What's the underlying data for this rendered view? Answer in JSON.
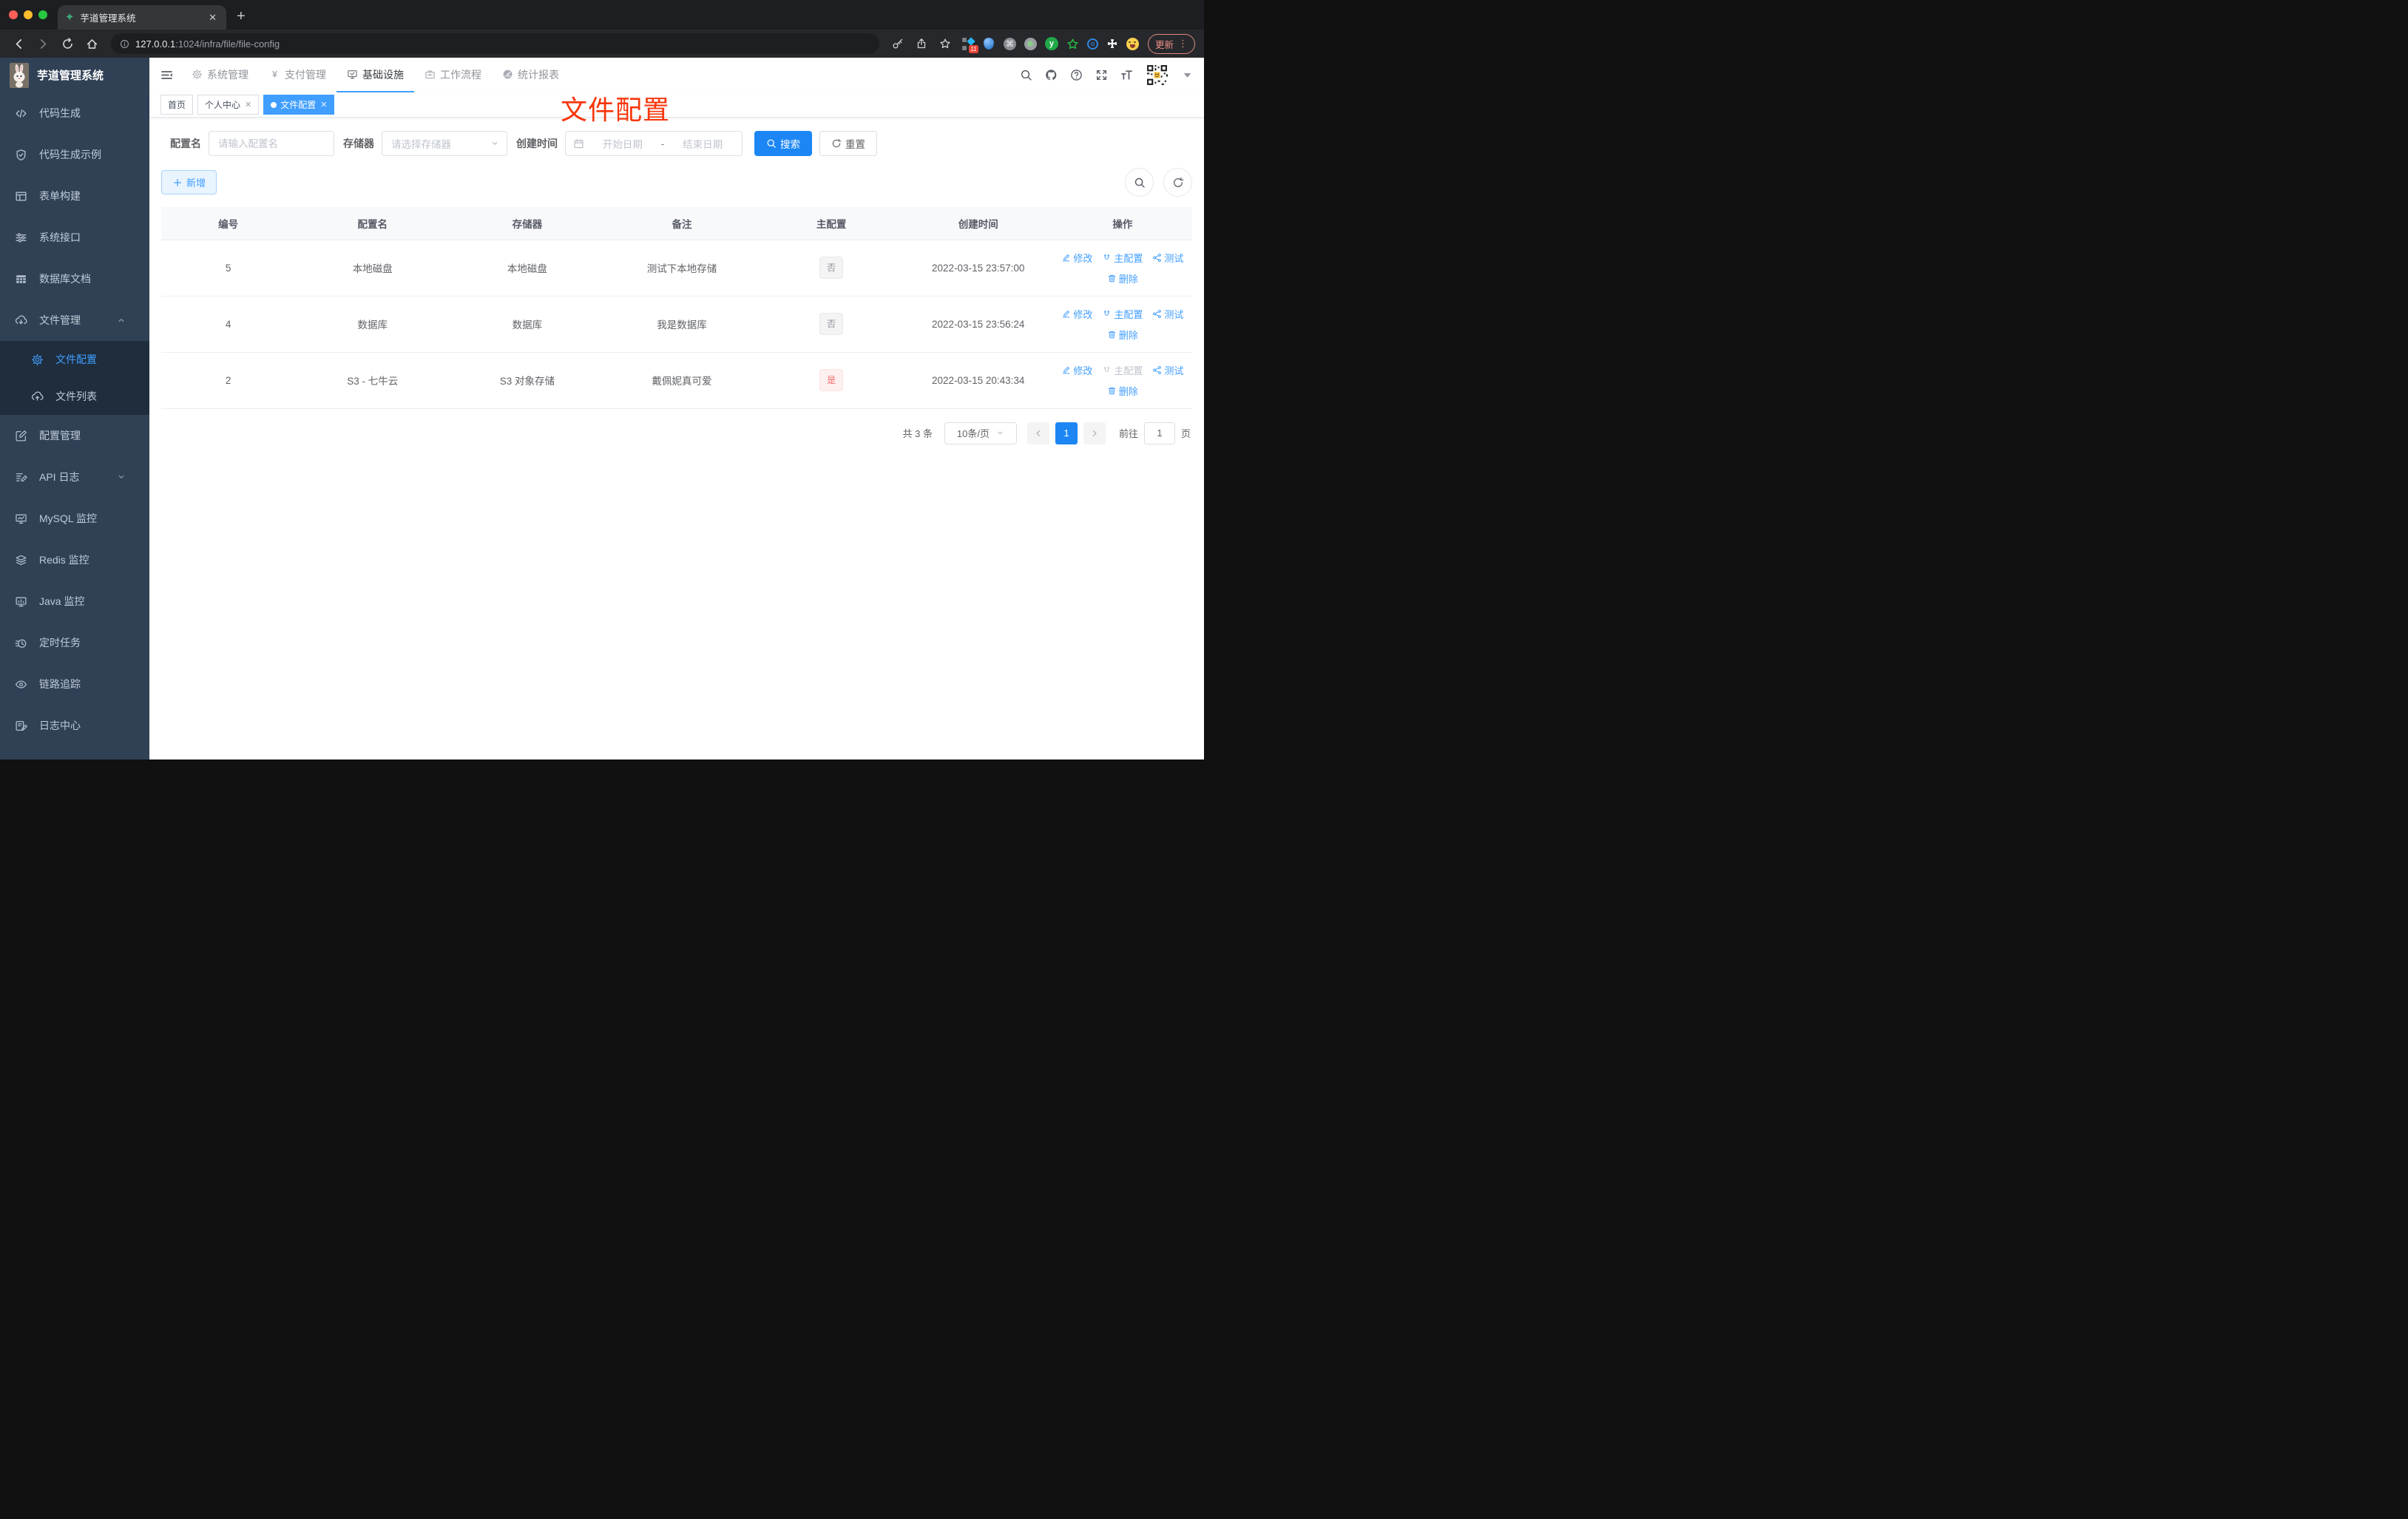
{
  "browser": {
    "tab_title": "芋道管理系统",
    "url_host": "127.0.0.1",
    "url_rest": ":1024/infra/file/file-config",
    "ext_badge": "11",
    "ext_y_label": "y",
    "ext_cmd_glyph": "⌘",
    "update_label": "更新"
  },
  "sidebar": {
    "title": "芋道管理系统",
    "items": [
      {
        "label": "代码生成",
        "icon": "code-icon"
      },
      {
        "label": "代码生成示例",
        "icon": "shield-check-icon"
      },
      {
        "label": "表单构建",
        "icon": "form-icon"
      },
      {
        "label": "系统接口",
        "icon": "sliders-icon"
      },
      {
        "label": "数据库文档",
        "icon": "grid-icon"
      },
      {
        "label": "文件管理",
        "icon": "cloud-download-icon",
        "expanded": true,
        "children": [
          {
            "label": "文件配置",
            "icon": "gear-icon",
            "active": true
          },
          {
            "label": "文件列表",
            "icon": "cloud-upload-icon"
          }
        ]
      },
      {
        "label": "配置管理",
        "icon": "edit-square-icon"
      },
      {
        "label": "API 日志",
        "icon": "note-edit-icon",
        "collapsible": true
      },
      {
        "label": "MySQL 监控",
        "icon": "monitor-chart-icon"
      },
      {
        "label": "Redis 监控",
        "icon": "layers-icon"
      },
      {
        "label": "Java 监控",
        "icon": "display-icon"
      },
      {
        "label": "定时任务",
        "icon": "timer-icon"
      },
      {
        "label": "链路追踪",
        "icon": "eye-icon"
      },
      {
        "label": "日志中心",
        "icon": "log-icon"
      }
    ]
  },
  "topnav": {
    "items": [
      {
        "label": "系统管理",
        "icon": "gear-icon"
      },
      {
        "label": "支付管理",
        "icon": "yen-icon"
      },
      {
        "label": "基础设施",
        "icon": "monitor-check-icon",
        "active": true
      },
      {
        "label": "工作流程",
        "icon": "briefcase-icon"
      },
      {
        "label": "统计报表",
        "icon": "dashboard-icon"
      }
    ]
  },
  "tags": [
    {
      "label": "首页"
    },
    {
      "label": "个人中心",
      "closable": true
    },
    {
      "label": "文件配置",
      "closable": true,
      "active": true
    }
  ],
  "annotation": {
    "text": "文件配置"
  },
  "filters": {
    "name_label": "配置名",
    "name_placeholder": "请输入配置名",
    "storage_label": "存储器",
    "storage_placeholder": "请选择存储器",
    "date_label": "创建时间",
    "date_start_placeholder": "开始日期",
    "date_separator": "-",
    "date_end_placeholder": "结束日期",
    "search_label": "搜索",
    "reset_label": "重置"
  },
  "toolbar": {
    "add_label": "新增"
  },
  "table": {
    "columns": [
      "编号",
      "配置名",
      "存储器",
      "备注",
      "主配置",
      "创建时间",
      "操作"
    ],
    "action_labels": {
      "edit": "修改",
      "master": "主配置",
      "test": "测试",
      "delete": "删除"
    },
    "rows": [
      {
        "id": "5",
        "name": "本地磁盘",
        "storage": "本地磁盘",
        "remark": "测试下本地存储",
        "master": "否",
        "master_type": "info",
        "created": "2022-03-15 23:57:00",
        "master_action_disabled": false
      },
      {
        "id": "4",
        "name": "数据库",
        "storage": "数据库",
        "remark": "我是数据库",
        "master": "否",
        "master_type": "info",
        "created": "2022-03-15 23:56:24",
        "master_action_disabled": false
      },
      {
        "id": "2",
        "name": "S3 - 七牛云",
        "storage": "S3 对象存储",
        "remark": "戴佩妮真可爱",
        "master": "是",
        "master_type": "danger",
        "created": "2022-03-15 20:43:34",
        "master_action_disabled": true
      }
    ]
  },
  "pagination": {
    "total": "共 3 条",
    "page_size": "10条/页",
    "current_page": "1",
    "goto_label": "前往",
    "goto_value": "1",
    "unit_label": "页"
  },
  "colors": {
    "primary": "#409eff",
    "danger": "#f56c6c",
    "annotation": "#f8350a",
    "sidebar": "#304156"
  }
}
